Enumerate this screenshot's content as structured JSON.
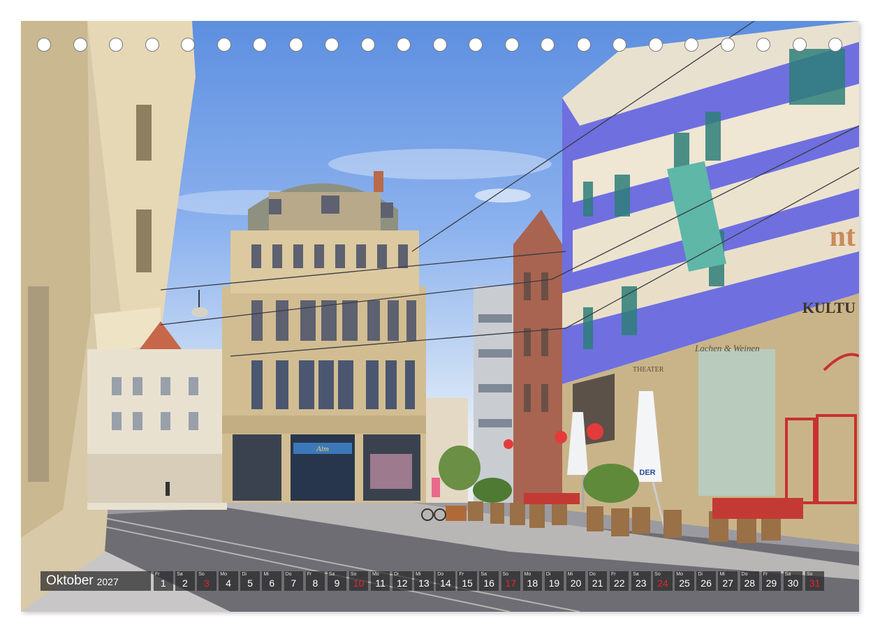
{
  "calendar": {
    "month": "Oktober",
    "year": "2027",
    "days": [
      {
        "wd": "Fr",
        "num": "1",
        "holiday": false
      },
      {
        "wd": "Sa",
        "num": "2",
        "holiday": false
      },
      {
        "wd": "So",
        "num": "3",
        "holiday": true
      },
      {
        "wd": "Mo",
        "num": "4",
        "holiday": false
      },
      {
        "wd": "Di",
        "num": "5",
        "holiday": false
      },
      {
        "wd": "Mi",
        "num": "6",
        "holiday": false
      },
      {
        "wd": "Do",
        "num": "7",
        "holiday": false
      },
      {
        "wd": "Fr",
        "num": "8",
        "holiday": false
      },
      {
        "wd": "Sa",
        "num": "9",
        "holiday": false
      },
      {
        "wd": "So",
        "num": "10",
        "holiday": true
      },
      {
        "wd": "Mo",
        "num": "11",
        "holiday": false
      },
      {
        "wd": "Di",
        "num": "12",
        "holiday": false
      },
      {
        "wd": "Mi",
        "num": "13",
        "holiday": false
      },
      {
        "wd": "Do",
        "num": "14",
        "holiday": false
      },
      {
        "wd": "Fr",
        "num": "15",
        "holiday": false
      },
      {
        "wd": "Sa",
        "num": "16",
        "holiday": false
      },
      {
        "wd": "So",
        "num": "17",
        "holiday": true
      },
      {
        "wd": "Mo",
        "num": "18",
        "holiday": false
      },
      {
        "wd": "Di",
        "num": "19",
        "holiday": false
      },
      {
        "wd": "Mi",
        "num": "20",
        "holiday": false
      },
      {
        "wd": "Do",
        "num": "21",
        "holiday": false
      },
      {
        "wd": "Fr",
        "num": "22",
        "holiday": false
      },
      {
        "wd": "Sa",
        "num": "23",
        "holiday": false
      },
      {
        "wd": "So",
        "num": "24",
        "holiday": true
      },
      {
        "wd": "Mo",
        "num": "25",
        "holiday": false
      },
      {
        "wd": "Di",
        "num": "26",
        "holiday": false
      },
      {
        "wd": "Mi",
        "num": "27",
        "holiday": false
      },
      {
        "wd": "Do",
        "num": "28",
        "holiday": false
      },
      {
        "wd": "Fr",
        "num": "29",
        "holiday": false
      },
      {
        "wd": "Sa",
        "num": "30",
        "holiday": false
      },
      {
        "wd": "So",
        "num": "31",
        "holiday": true
      }
    ]
  },
  "photo": {
    "signs": {
      "shop": "Alm",
      "culture": "KULTU",
      "cafe": "Lachen & Weinen",
      "theater": "THEATER",
      "brand": "nt",
      "umbrella": "DER"
    },
    "colors": {
      "blue_facade": "#6f6fe0",
      "sandstone": "#c9b48a",
      "sky": "#7aa4ea",
      "holiday_red": "#e8242b"
    }
  }
}
